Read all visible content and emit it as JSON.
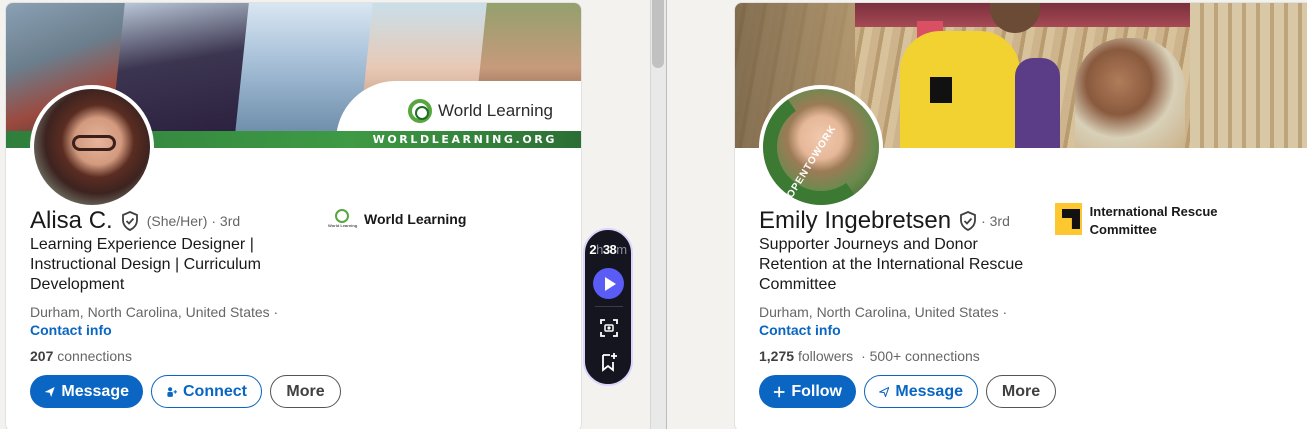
{
  "widget": {
    "timer_hours": "2",
    "timer_h": "h",
    "timer_minutes": "38",
    "timer_m": "m"
  },
  "cards": [
    {
      "banner_brand": "World Learning",
      "banner_url_text": "WORLDLEARNING.ORG",
      "name": "Alisa C.",
      "pronouns": "(She/Her)",
      "degree": "· 3rd",
      "headline": "Learning Experience Designer | Instructional Design | Curriculum Development",
      "location": "Durham, North Carolina, United States ·",
      "contact": "Contact info",
      "connections_count": "207",
      "connections_label": "connections",
      "company": "World Learning",
      "company_logo_text": "World Learning",
      "buttons": {
        "primary": "Message",
        "secondary": "Connect",
        "more": "More"
      }
    },
    {
      "name": "Emily Ingebretsen",
      "degree": "· 3rd",
      "open_to_work": "#OPENTOWORK",
      "headline": "Supporter Journeys and Donor Retention at the International Rescue Committee",
      "location": "Durham, North Carolina, United States ·",
      "contact": "Contact info",
      "followers_count": "1,275",
      "followers_label": "followers",
      "connections_text": "· 500+ connections",
      "company": "International Rescue Committee",
      "buttons": {
        "primary": "Follow",
        "secondary": "Message",
        "more": "More"
      }
    }
  ],
  "colors": {
    "linkedin_blue": "#0a66c2",
    "wl_green": "#3e9a44",
    "irc_yellow": "#fdc82f",
    "widget_bg": "#15151f",
    "widget_play": "#5b5bf5"
  }
}
